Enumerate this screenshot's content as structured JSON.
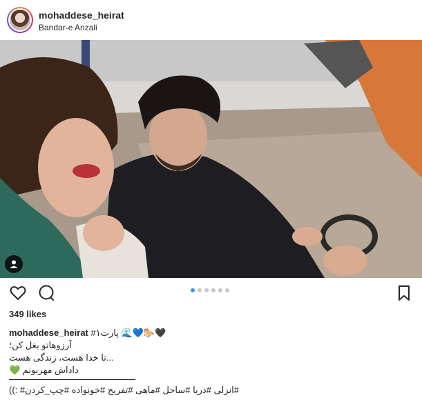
{
  "header": {
    "username": "mohaddese_heirat",
    "location": "Bandar-e Anzali"
  },
  "photo": {
    "alt_icon": "person-tag-icon"
  },
  "actions": {
    "like_icon": "heart-icon",
    "comment_icon": "comment-icon",
    "save_icon": "bookmark-icon",
    "carousel_total": 6,
    "carousel_active": 1
  },
  "likes": {
    "text": "349 likes"
  },
  "caption": {
    "author": "mohaddese_heirat",
    "line1": "#پارت۱ 🌊💙🐎🖤",
    "line2": "آرزوهاتو بغل کن؛",
    "line3": "...تا خدا هست، زندگی هست",
    "line4": "داداش مهربونم 💚",
    "hashtags": "#انزلی #دریا #ساحل #ماهی #تفریح #خونواده #چپ_کردن# :))"
  },
  "colors": {
    "text": "#262626",
    "accent_blue": "#3897f0",
    "dot_inactive": "#c7c7c7"
  }
}
